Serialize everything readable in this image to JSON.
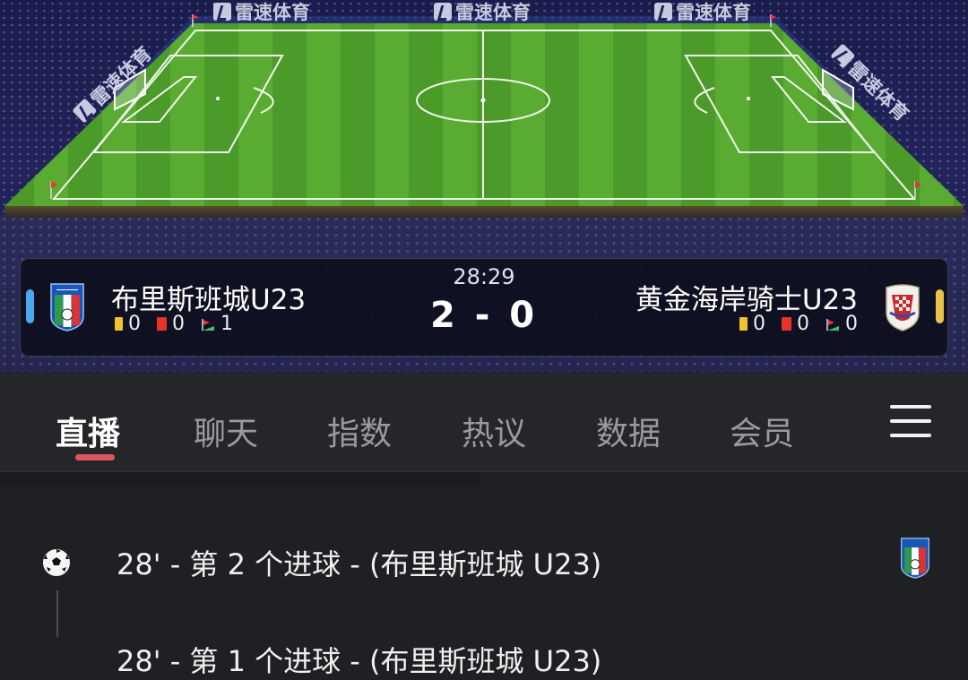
{
  "stadium": {
    "ad_text": "雷速体育"
  },
  "match": {
    "time": "28:29",
    "score": "2 - 0",
    "home": {
      "name": "布里斯班城U23",
      "yellow_cards": "0",
      "red_cards": "0",
      "corners": "1",
      "color": "#4aa9f0"
    },
    "away": {
      "name": "黄金海岸骑士U23",
      "yellow_cards": "0",
      "red_cards": "0",
      "corners": "0",
      "color": "#e8c34a"
    }
  },
  "tabs": [
    {
      "label": "直播",
      "active": true
    },
    {
      "label": "聊天"
    },
    {
      "label": "指数"
    },
    {
      "label": "热议"
    },
    {
      "label": "数据"
    },
    {
      "label": "会员"
    }
  ],
  "feed": {
    "events": [
      {
        "text": "28' - 第 2 个进球 - (布里斯班城 U23)",
        "icon": "soccer-ball-icon"
      },
      {
        "text": "28' - 第 1 个进球 - (布里斯班城 U23)"
      }
    ]
  },
  "colors": {
    "accent": "#e0565f",
    "yellow_card": "#f2c230",
    "red_card": "#e8322a"
  }
}
